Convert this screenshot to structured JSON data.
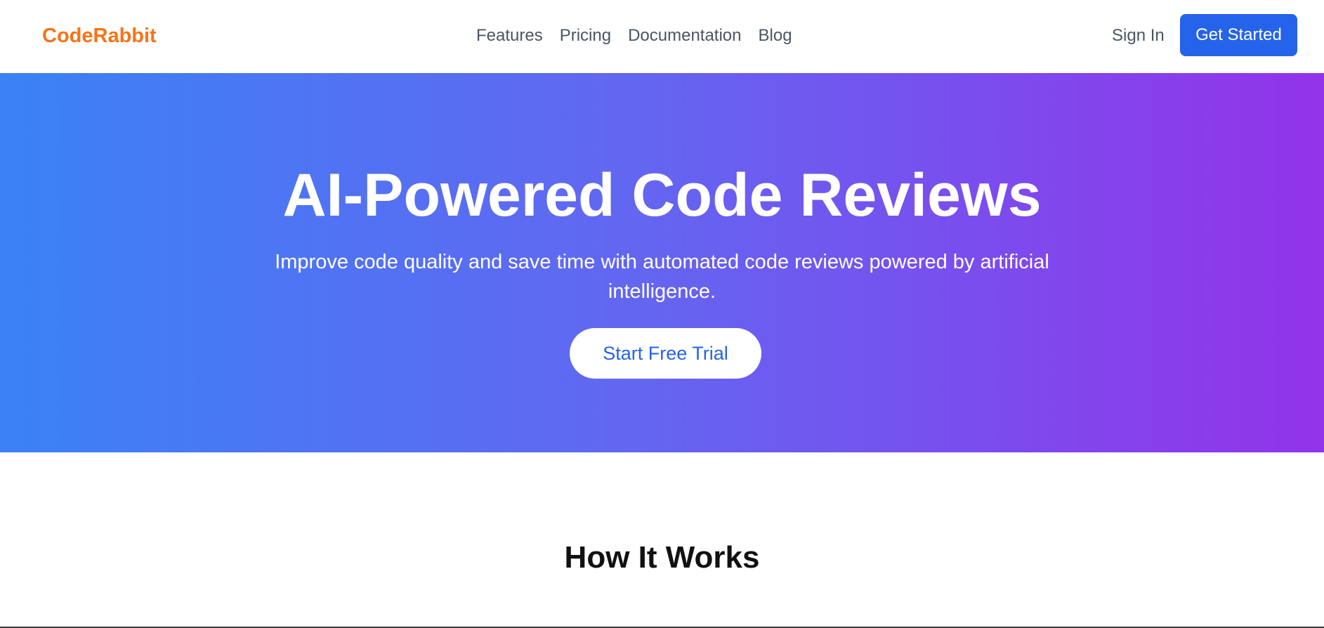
{
  "header": {
    "logo": "CodeRabbit",
    "nav": [
      {
        "label": "Features"
      },
      {
        "label": "Pricing"
      },
      {
        "label": "Documentation"
      },
      {
        "label": "Blog"
      }
    ],
    "sign_in": "Sign In",
    "get_started": "Get Started"
  },
  "hero": {
    "title": "AI-Powered Code Reviews",
    "subtitle": "Improve code quality and save time with automated code reviews powered by artificial intelligence.",
    "cta": "Start Free Trial"
  },
  "how_it_works": {
    "title": "How It Works"
  },
  "colors": {
    "logo": "#f97316",
    "primary": "#2563eb",
    "gradient_start": "#3b82f6",
    "gradient_end": "#9333ea"
  }
}
